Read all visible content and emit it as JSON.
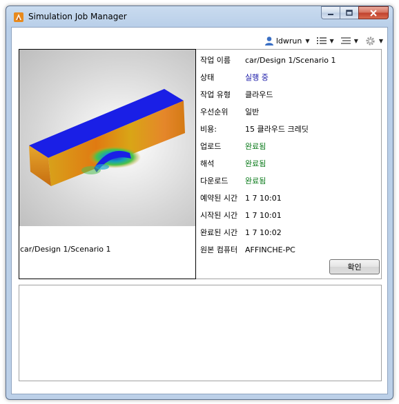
{
  "window": {
    "title": "Simulation Job Manager",
    "icon": "autodesk-sim-icon",
    "buttons": {
      "minimize": "minimize-icon",
      "maximize": "maximize-icon",
      "close": "close-icon"
    }
  },
  "toolbar": {
    "user": "ldwrun",
    "user_icon": "user-icon",
    "list_icon": "list-view-icon",
    "filter_icon": "filter-list-icon",
    "settings_icon": "gear-icon"
  },
  "job": {
    "thumbnail_caption": "car/Design 1/Scenario 1",
    "fields": [
      {
        "key": "작업 이름",
        "value": "car/Design 1/Scenario 1",
        "tone": "normal"
      },
      {
        "key": "상태",
        "value": "실행 중",
        "tone": "blue"
      },
      {
        "key": "작업 유형",
        "value": "클라우드",
        "tone": "normal"
      },
      {
        "key": "우선순위",
        "value": "일반",
        "tone": "normal"
      },
      {
        "key": "비용:",
        "value": "15 클라우드 크레딧",
        "tone": "normal"
      },
      {
        "key": "업로드",
        "value": "완료됨",
        "tone": "green"
      },
      {
        "key": "해석",
        "value": "완료됨",
        "tone": "green"
      },
      {
        "key": "다운로드",
        "value": "완료됨",
        "tone": "green"
      },
      {
        "key": "예약된 시간",
        "value": "1 7 10:01",
        "tone": "normal"
      },
      {
        "key": "시작된 시간",
        "value": "1 7 10:01",
        "tone": "normal"
      },
      {
        "key": "완료된 시간",
        "value": "1 7 10:02",
        "tone": "normal"
      },
      {
        "key": "원본 컴퓨터",
        "value": "AFFINCHE-PC",
        "tone": "normal"
      }
    ],
    "ok_label": "확인"
  },
  "colors": {
    "running": "#1a1aa8",
    "completed": "#0a7a1a"
  }
}
